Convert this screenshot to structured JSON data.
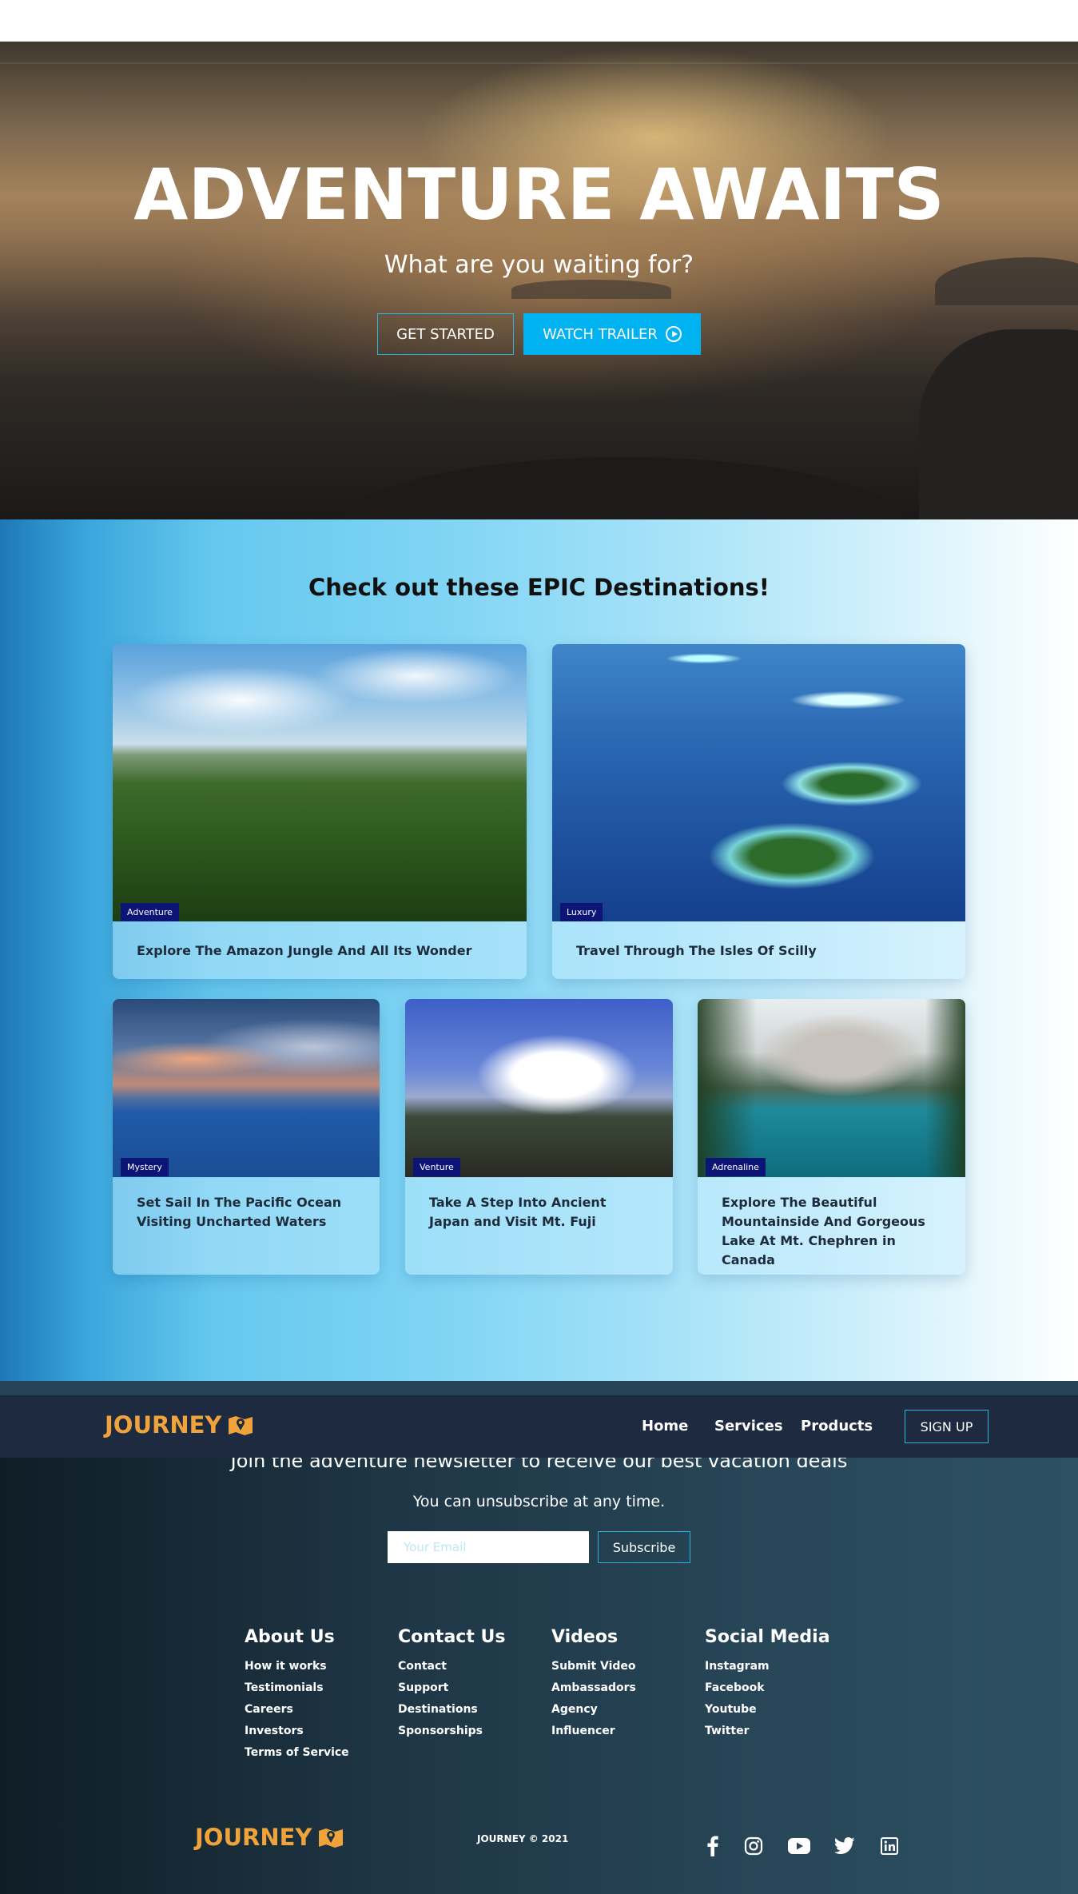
{
  "hero": {
    "title": "ADVENTURE AWAITS",
    "subtitle": "What are you waiting for?",
    "get_started_label": "GET STARTED",
    "watch_trailer_label": "WATCH TRAILER"
  },
  "destinations": {
    "heading": "Check out these EPIC Destinations!",
    "cards": [
      {
        "tag": "Adventure",
        "title": "Explore The Amazon Jungle And All Its Wonder",
        "image": "jungle-image"
      },
      {
        "tag": "Luxury",
        "title": "Travel Through The Isles Of Scilly",
        "image": "islands-image"
      },
      {
        "tag": "Mystery",
        "title": "Set Sail In The Pacific Ocean Visiting Uncharted Waters",
        "image": "ocean-image"
      },
      {
        "tag": "Venture",
        "title": "Take A Step Into Ancient Japan and Visit Mt. Fuji",
        "image": "fuji-image"
      },
      {
        "tag": "Adrenaline",
        "title": "Explore The Beautiful Mountainside And Gorgeous Lake At Mt. Chephren in Canada",
        "image": "lake-image"
      }
    ]
  },
  "navbar": {
    "logo": "JOURNEY",
    "links": [
      "Home",
      "Services",
      "Products"
    ],
    "signup_label": "SIGN UP"
  },
  "newsletter": {
    "heading": "Join the adventure newsletter to receive our best vacation deals",
    "subtext": "You can unsubscribe at any time.",
    "email_placeholder": "Your Email",
    "subscribe_label": "Subscribe"
  },
  "footer": {
    "columns": [
      {
        "title": "About Us",
        "links": [
          "How it works",
          "Testimonials",
          "Careers",
          "Investors",
          "Terms of Service"
        ]
      },
      {
        "title": "Contact Us",
        "links": [
          "Contact",
          "Support",
          "Destinations",
          "Sponsorships"
        ]
      },
      {
        "title": "Videos",
        "links": [
          "Submit Video",
          "Ambassadors",
          "Agency",
          "Influencer"
        ]
      },
      {
        "title": "Social Media",
        "links": [
          "Instagram",
          "Facebook",
          "Youtube",
          "Twitter"
        ]
      }
    ],
    "logo": "JOURNEY",
    "copyright": "JOURNEY © 2021",
    "social_icons": [
      "facebook-icon",
      "instagram-icon",
      "youtube-icon",
      "twitter-icon",
      "linkedin-icon"
    ]
  },
  "colors": {
    "accent": "#00b2f0",
    "logo": "#f0a33a",
    "tag_bg": "#0c1476",
    "navbar_bg": "#1e2a40"
  }
}
